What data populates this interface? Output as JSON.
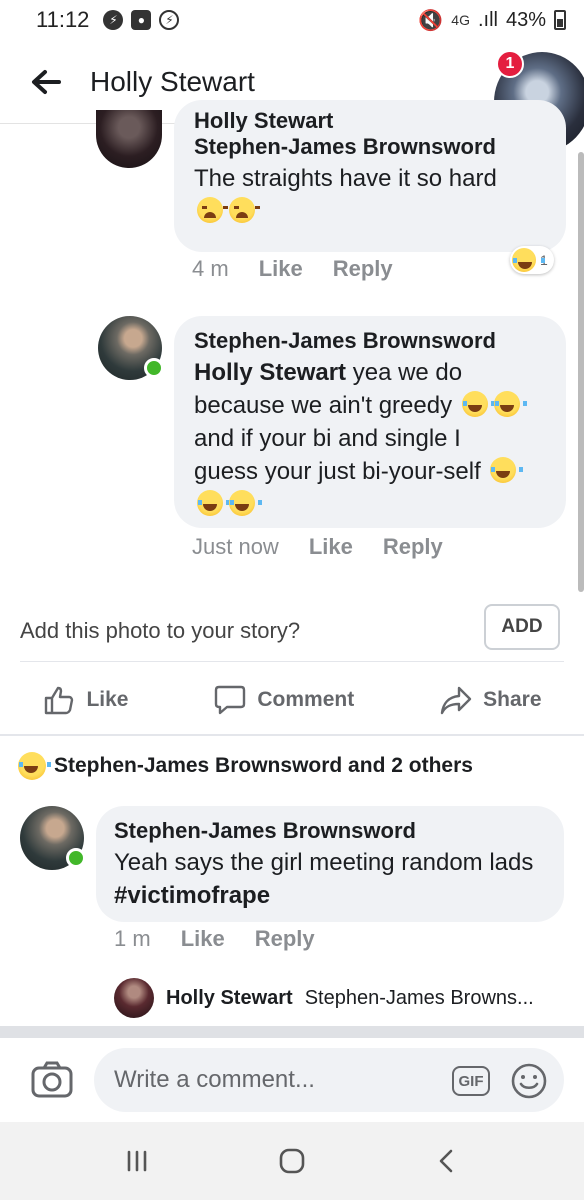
{
  "status_bar": {
    "time": "11:12",
    "network": "4G",
    "battery": "43%"
  },
  "header": {
    "title": "Holly Stewart",
    "chat_head_badge": "1"
  },
  "comments": [
    {
      "author": "Holly Stewart",
      "mention": "Stephen-James Brownsword",
      "text": "The straights have it so hard",
      "time": "4 m",
      "like": "Like",
      "reply": "Reply",
      "reaction_count": "1"
    },
    {
      "author": "Stephen-James Brownsword",
      "mention": "Holly Stewart",
      "line1": "yea we do",
      "line2": "because we ain't greedy",
      "line3": "and if your bi and single I",
      "line4": "guess your just bi-your-self",
      "time": "Just now",
      "like": "Like",
      "reply": "Reply"
    }
  ],
  "story": {
    "prompt": "Add this photo to your story?",
    "button": "ADD"
  },
  "actions": {
    "like": "Like",
    "comment": "Comment",
    "share": "Share"
  },
  "reactions_summary": "Stephen-James Brownsword and 2 others",
  "post_comment": {
    "author": "Stephen-James Brownsword",
    "text": "Yeah says the girl meeting random lads",
    "hashtag": "#victimofrape",
    "time": "1 m",
    "like": "Like",
    "reply": "Reply"
  },
  "reply_preview": {
    "author": "Holly Stewart",
    "text": "Stephen-James Browns..."
  },
  "composer": {
    "placeholder": "Write a comment...",
    "gif": "GIF"
  }
}
